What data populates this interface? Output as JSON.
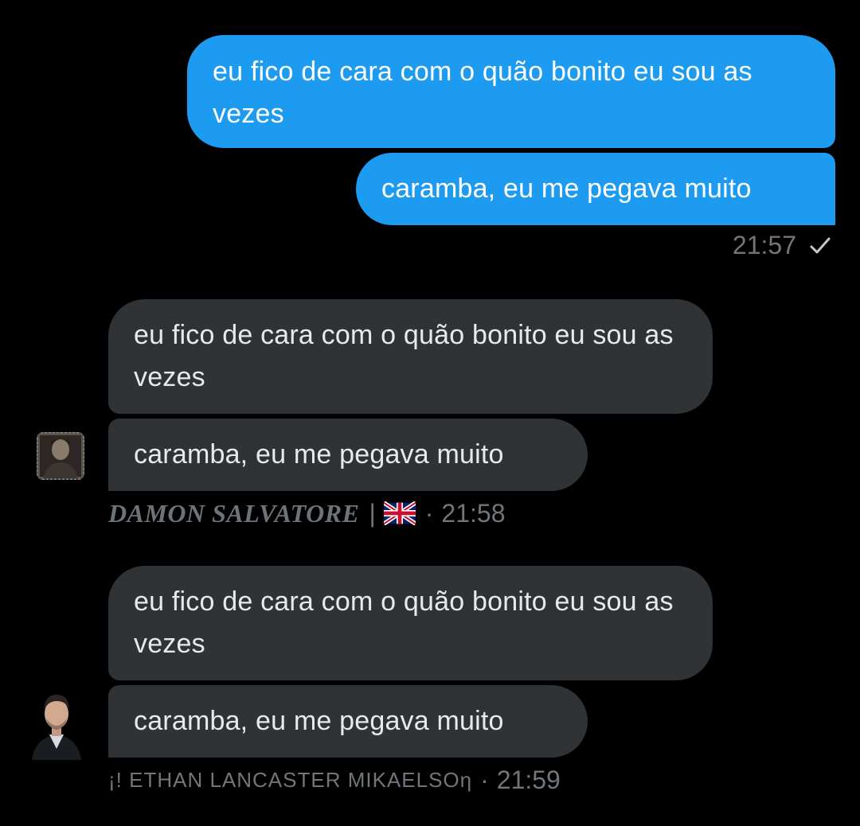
{
  "outgoing": {
    "messages": [
      "eu fico de cara com o quão bonito eu sou as vezes",
      "caramba, eu me pegava muito"
    ],
    "time": "21:57",
    "status_icon": "check-icon"
  },
  "incoming": [
    {
      "messages": [
        "eu fico de cara com o quão bonito eu sou as vezes",
        "caramba, eu me pegava muito"
      ],
      "sender_name": "DAMON SALVATORE",
      "separator": "|",
      "flag_icon": "uk-flag-icon",
      "dot": "·",
      "time": "21:58"
    },
    {
      "messages": [
        "eu fico de cara com o quão bonito eu sou as vezes",
        "caramba, eu me pegava muito"
      ],
      "sender_name": "¡! ETHAN LANCASTER MIKAELSOη",
      "dot": "·",
      "time": "21:59"
    }
  ],
  "colors": {
    "sent_bubble": "#1d9bf0",
    "received_bubble": "#2f3336",
    "background": "#000000",
    "meta_text": "#71767b"
  }
}
